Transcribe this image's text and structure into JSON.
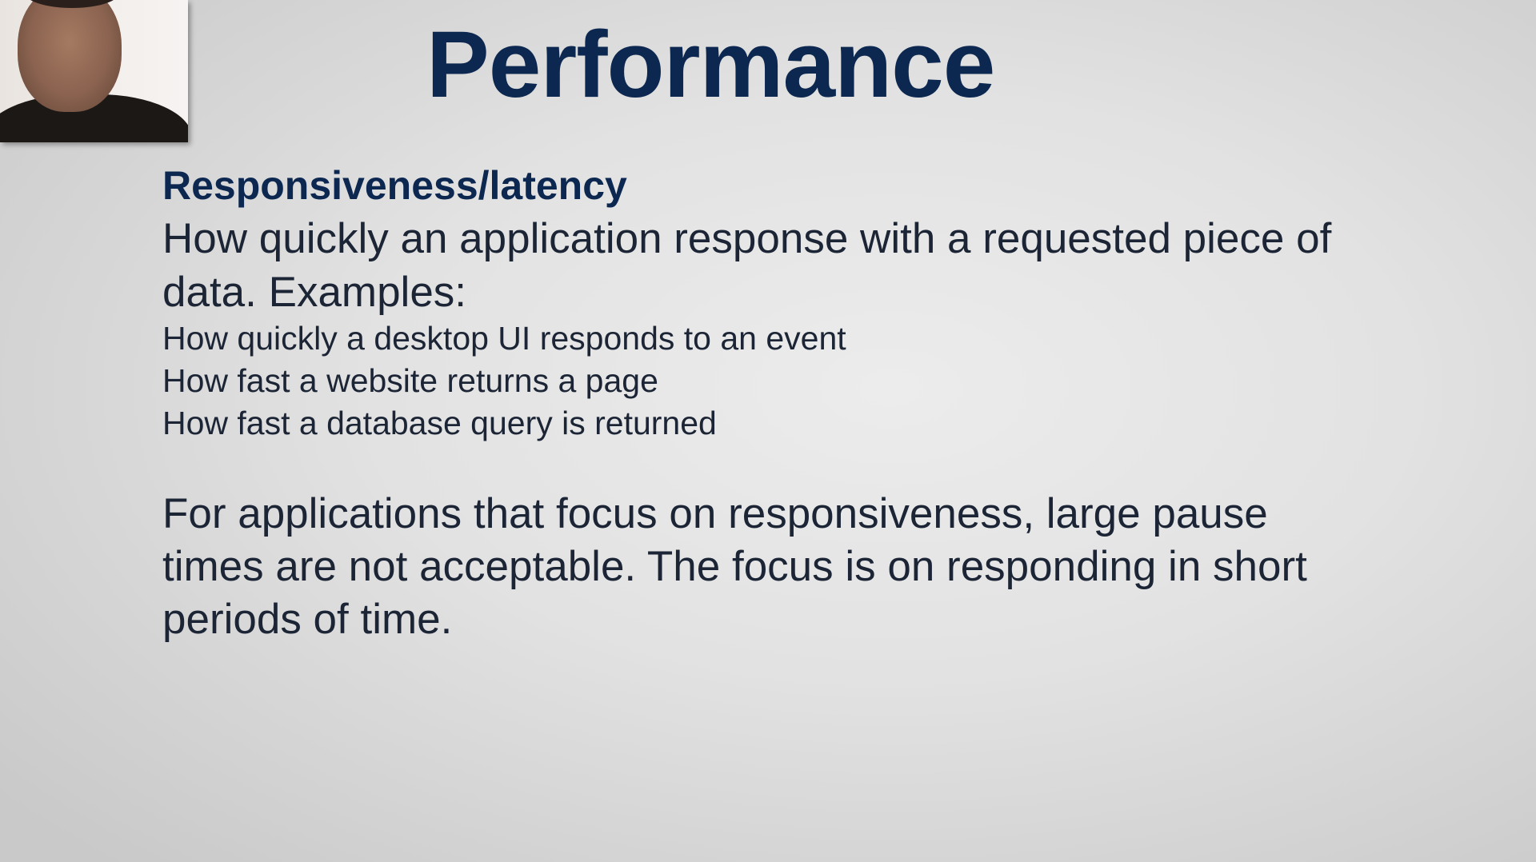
{
  "slide": {
    "title": "Performance",
    "heading": "Responsiveness/latency",
    "definition_lines": [
      "How quickly an application response with a requested piece of",
      "data. Examples:"
    ],
    "examples": [
      "How quickly a desktop UI responds to an event",
      "How fast a website returns a page",
      "How fast a database query is returned"
    ],
    "conclusion_lines": [
      "For applications that focus on responsiveness, large pause",
      "times are not acceptable. The focus is on responding in short",
      "periods of time."
    ]
  },
  "colors": {
    "title": "#0c2750",
    "text": "#1c2535"
  }
}
